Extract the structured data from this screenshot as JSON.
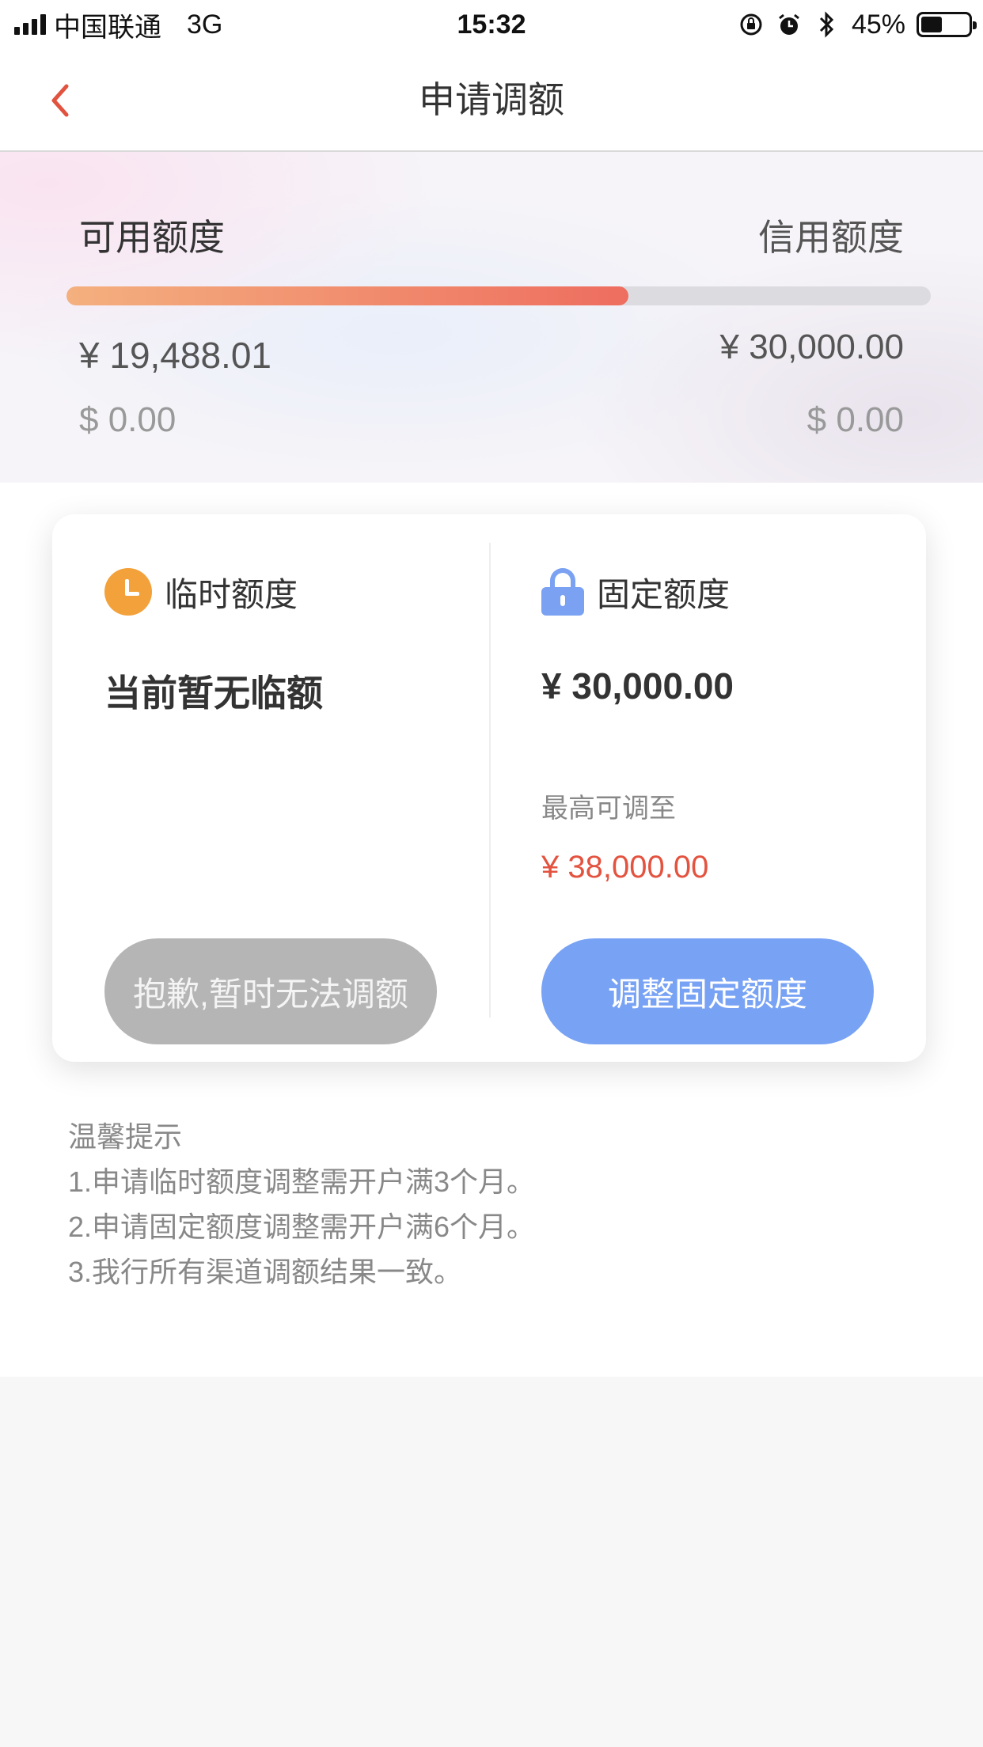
{
  "status_bar": {
    "carrier": "中国联通",
    "network": "3G",
    "time": "15:32",
    "battery_percent": "45%",
    "battery_level": 0.45,
    "icons": [
      "signal-icon",
      "rotation-lock-icon",
      "alarm-icon",
      "bluetooth-icon",
      "battery-icon"
    ]
  },
  "nav": {
    "title": "申请调额",
    "back_icon": "chevron-left-icon"
  },
  "credit_summary": {
    "available_label": "可用额度",
    "limit_label": "信用额度",
    "available_cny": "¥ 19,488.01",
    "limit_cny": "¥ 30,000.00",
    "available_usd": "$ 0.00",
    "limit_usd": "$ 0.00",
    "usage_fraction": 0.65
  },
  "temporary": {
    "title": "临时额度",
    "icon": "clock-icon",
    "status": "当前暂无临额",
    "button_label": "抱歉,暂时无法调额"
  },
  "fixed": {
    "title": "固定额度",
    "icon": "lock-icon",
    "amount": "¥ 30,000.00",
    "max_label": "最高可调至",
    "max_value": "¥ 38,000.00",
    "button_label": "调整固定额度"
  },
  "tips": {
    "title": "温馨提示",
    "items": [
      "1.申请临时额度调整需开户满3个月。",
      "2.申请固定额度调整需开户满6个月。",
      "3.我行所有渠道调额结果一致。"
    ]
  },
  "colors": {
    "accent_blue": "#78a2f4",
    "accent_red": "#e3533f",
    "clock_orange": "#f3a13a",
    "disabled_gray": "#b5b5b5"
  }
}
